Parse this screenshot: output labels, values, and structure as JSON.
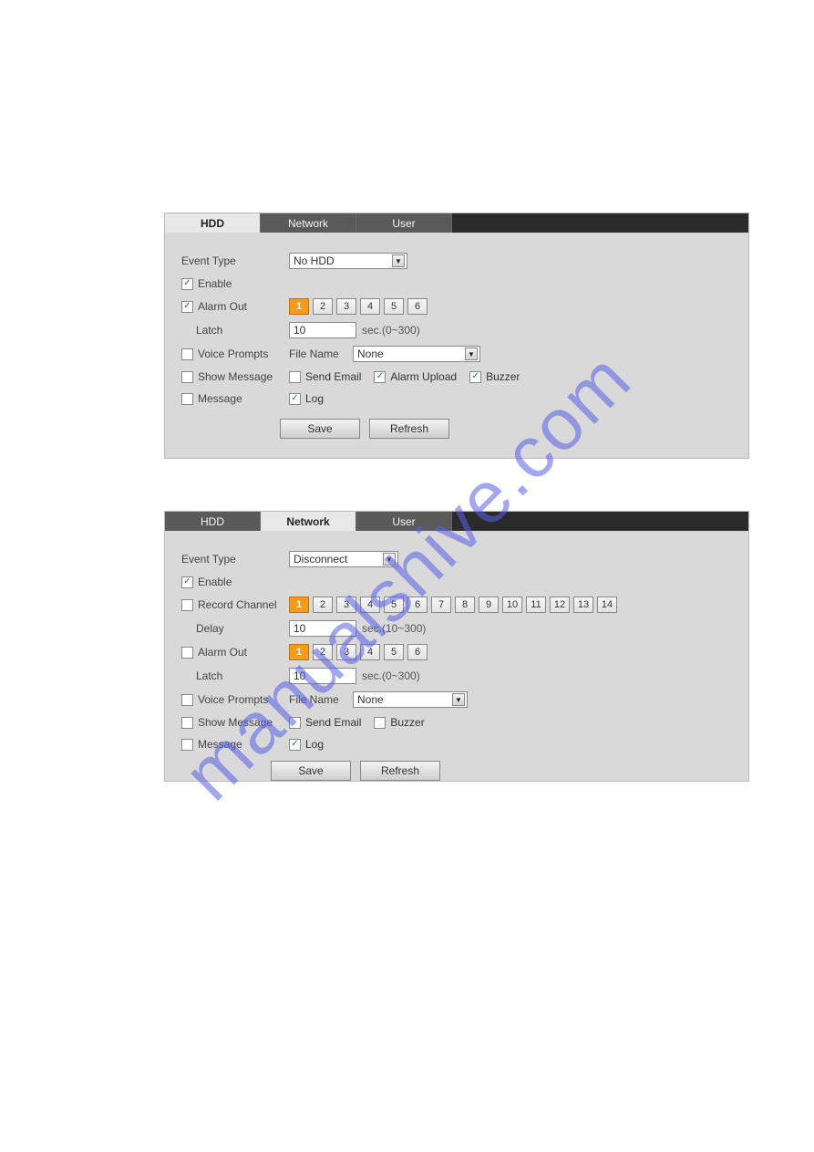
{
  "watermark": "manualshive.com",
  "panel1": {
    "tabs": {
      "hdd": "HDD",
      "network": "Network",
      "user": "User"
    },
    "eventType": {
      "label": "Event Type",
      "value": "No HDD"
    },
    "enable": {
      "label": "Enable",
      "checked": "✓"
    },
    "alarmOut": {
      "label": "Alarm Out",
      "checked": "✓",
      "buttons": [
        "1",
        "2",
        "3",
        "4",
        "5",
        "6"
      ],
      "selectedIndex": 0
    },
    "latch": {
      "label": "Latch",
      "value": "10",
      "hint": "sec.(0~300)"
    },
    "voicePrompts": {
      "label": "Voice Prompts",
      "fileNameLabel": "File Name",
      "fileNameValue": "None"
    },
    "showMessage": {
      "label": "Show Message"
    },
    "sendEmail": {
      "label": "Send Email"
    },
    "alarmUpload": {
      "label": "Alarm Upload",
      "checked": "✓"
    },
    "buzzer": {
      "label": "Buzzer",
      "checked": "✓"
    },
    "message": {
      "label": "Message"
    },
    "log": {
      "label": "Log",
      "checked": "✓"
    },
    "save": "Save",
    "refresh": "Refresh"
  },
  "panel2": {
    "tabs": {
      "hdd": "HDD",
      "network": "Network",
      "user": "User"
    },
    "eventType": {
      "label": "Event Type",
      "value": "Disconnect"
    },
    "enable": {
      "label": "Enable",
      "checked": "✓"
    },
    "recordChannel": {
      "label": "Record Channel",
      "buttons": [
        "1",
        "2",
        "3",
        "4",
        "5",
        "6",
        "7",
        "8",
        "9",
        "10",
        "11",
        "12",
        "13",
        "14"
      ],
      "selectedIndex": 0
    },
    "delay": {
      "label": "Delay",
      "value": "10",
      "hint": "sec.(10~300)"
    },
    "alarmOut": {
      "label": "Alarm Out",
      "buttons": [
        "1",
        "2",
        "3",
        "4",
        "5",
        "6"
      ],
      "selectedIndex": 0
    },
    "latch": {
      "label": "Latch",
      "value": "10",
      "hint": "sec.(0~300)"
    },
    "voicePrompts": {
      "label": "Voice Prompts",
      "fileNameLabel": "File Name",
      "fileNameValue": "None"
    },
    "showMessage": {
      "label": "Show Message"
    },
    "sendEmail": {
      "label": "Send Email"
    },
    "buzzer": {
      "label": "Buzzer"
    },
    "message": {
      "label": "Message"
    },
    "log": {
      "label": "Log",
      "checked": "✓"
    },
    "save": "Save",
    "refresh": "Refresh"
  }
}
